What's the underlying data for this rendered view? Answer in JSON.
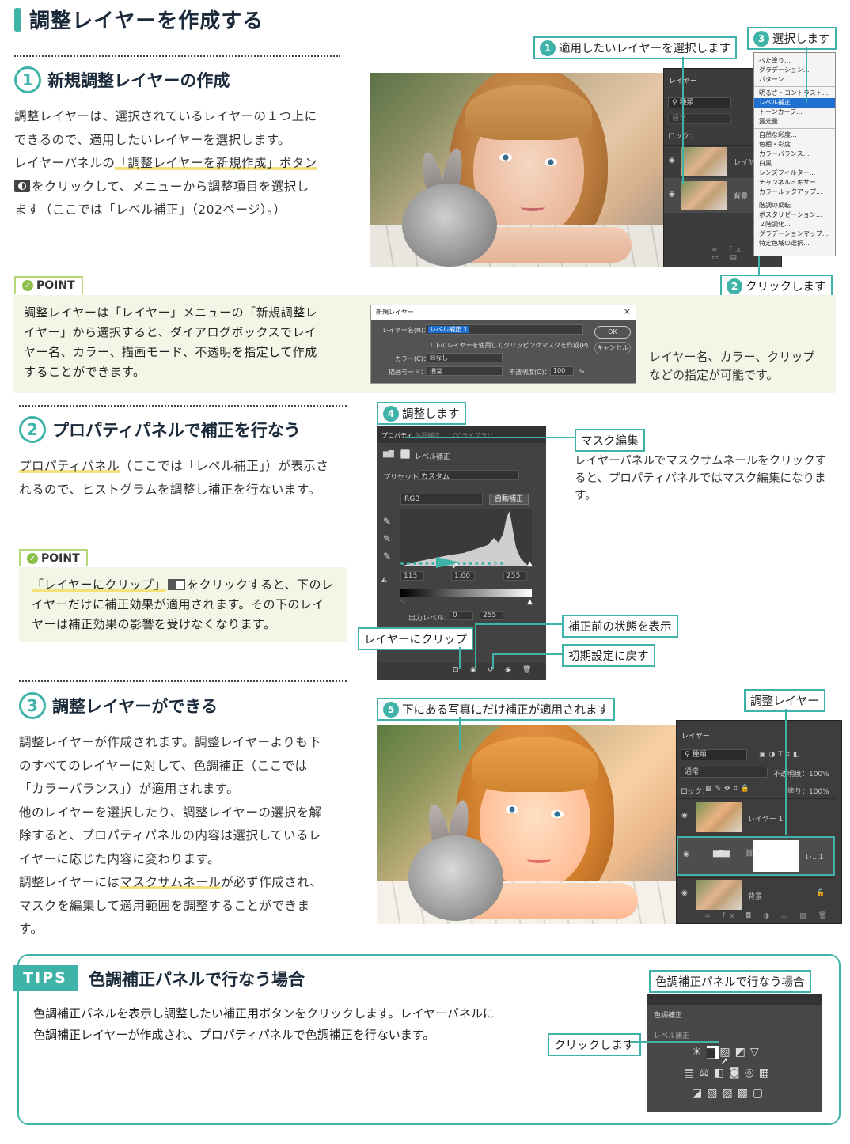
{
  "page_title": "調整レイヤーを作成する",
  "s1": {
    "num": "1",
    "title": "新規調整レイヤーの作成",
    "lines": [
      "調整レイヤーは、選択されているレイヤーの１つ上に",
      "できるので、適用したいレイヤーを選択します。",
      "レイヤーパネルの",
      "「調整レイヤーを新規作成」ボタン",
      "をクリックして、メニューから調整項目を選択し",
      "ます（ここでは「レベル補正」（202ページ）。）"
    ]
  },
  "point1": {
    "tag": "POINT",
    "lines": [
      "調整レイヤーは「レイヤー」メニューの「新規調整レ",
      "イヤー」から選択すると、ダイアログボックスでレイ",
      "ヤー名、カラー、描画モード、不透明を指定して作成",
      "することができます。"
    ],
    "caption_lines": [
      "レイヤー名、カラー、クリップ",
      "などの指定が可能です。"
    ]
  },
  "callouts1": {
    "c1_num": "1",
    "c1": "適用したいレイヤーを選択します",
    "c2_num": "2",
    "c2": "クリックします",
    "c3_num": "3",
    "c3": "選択します"
  },
  "layers_panel1": {
    "title": "レイヤー",
    "search": "種類",
    "mode": "通常",
    "lock": "ロック：",
    "row1": "レイヤー",
    "row2": "背景"
  },
  "adj_menu": {
    "items_a": [
      "べた塗り...",
      "グラデーション...",
      "パターン..."
    ],
    "items_b": [
      "明るさ・コントラスト...",
      "レベル補正...",
      "トーンカーブ...",
      "露光量..."
    ],
    "items_c": [
      "自然な彩度...",
      "色相・彩度...",
      "カラーバランス...",
      "白黒...",
      "レンズフィルター...",
      "チャンネルミキサー...",
      "カラールックアップ..."
    ],
    "items_d": [
      "階調の反転",
      "ポスタリゼーション...",
      "２階調化...",
      "グラデーションマップ...",
      "特定色域の選択..."
    ]
  },
  "dialog": {
    "title": "新規レイヤー",
    "name_label": "レイヤー名(N)：",
    "name_value": "レベル補正 1",
    "clip_label": "下のレイヤーを使用してクリッピングマスクを作成(P)",
    "color_label": "カラー(C)：",
    "color_value": "なし",
    "mode_label": "描画モード：",
    "mode_value": "通常",
    "opacity_label": "不透明度(O)：",
    "opacity_value": "100",
    "opacity_unit": "%",
    "ok": "OK",
    "cancel": "キャンセル"
  },
  "s2": {
    "num": "2",
    "title": "プロパティパネルで補正を行なう",
    "lines": [
      "プロパティパネル",
      "（ここでは「レベル補正」）が表示さ",
      "れるので、ヒストグラムを調整し補正を行ないます。"
    ]
  },
  "point2": {
    "tag": "POINT",
    "lines": [
      "「レイヤーにクリップ」",
      "をクリックすると、下のレ",
      "イヤーだけに補正効果が適用されます。その下のレイ",
      "ヤーは補正効果の影響を受けなくなります。"
    ]
  },
  "props": {
    "tab1": "プロパティ",
    "tab2": "色調補正",
    "tab3": "CCライブラリ",
    "heading": "レベル補正",
    "preset_label": "プリセット：",
    "preset_value": "カスタム",
    "channel": "RGB",
    "auto": "自動補正",
    "in_black": "113",
    "in_mid": "1.00",
    "in_white": "255",
    "out_label": "出力レベル：",
    "out_black": "0",
    "out_white": "255"
  },
  "callouts2": {
    "c4_num": "4",
    "c4": "調整します",
    "mask": "マスク編集",
    "mask_note_lines": [
      "レイヤーパネルでマスクサムネールをクリックす",
      "ると、プロパティパネルではマスク編集になりま",
      "す。"
    ],
    "prev": "補正前の状態を表示",
    "reset": "初期設定に戻す",
    "clip": "レイヤーにクリップ"
  },
  "s3": {
    "num": "3",
    "title": "調整レイヤーができる",
    "lines": [
      "調整レイヤーが作成されます。調整レイヤーよりも下",
      "のすべてのレイヤーに対して、色調補正（ここでは",
      "「カラーバランス」）が適用されます。",
      "他のレイヤーを選択したり、調整レイヤーの選択を解",
      "除すると、プロパティパネルの内容は選択しているレ",
      "イヤーに応じた内容に変わります。",
      "調整レイヤーには",
      "マスクサムネール",
      "が必ず作成され、",
      "マスクを編集して適用範囲を調整することができま",
      "す。"
    ]
  },
  "callouts3": {
    "c5_num": "5",
    "c5": "下にある写真にだけ補正が適用されます",
    "adj_layer": "調整レイヤー"
  },
  "layers_panel2": {
    "title": "レイヤー",
    "search": "種類",
    "mode": "通常",
    "opacity": "不透明度：100%",
    "lock": "ロック：",
    "fill": "塗り：100%",
    "row1": "レイヤー 1",
    "row2": "レ...1",
    "row3": "背景"
  },
  "tips": {
    "tag": "TIPS",
    "title": "色調補正パネルで行なう場合",
    "lines": [
      "色調補正パネルを表示し調整したい補正用ボタンをクリックします。レイヤーパネルに",
      "色調補正レイヤーが作成され、プロパティパネルで色調補正を行ないます。"
    ],
    "fig_label": "色調補正パネルで行なう場合",
    "panel_title": "色調補正",
    "panel_sub": "レベル補正",
    "click": "クリックします"
  },
  "colors": {
    "accent": "#3fb3a8",
    "point_bg": "#f3f6e6",
    "underline": "#f3e27a"
  }
}
